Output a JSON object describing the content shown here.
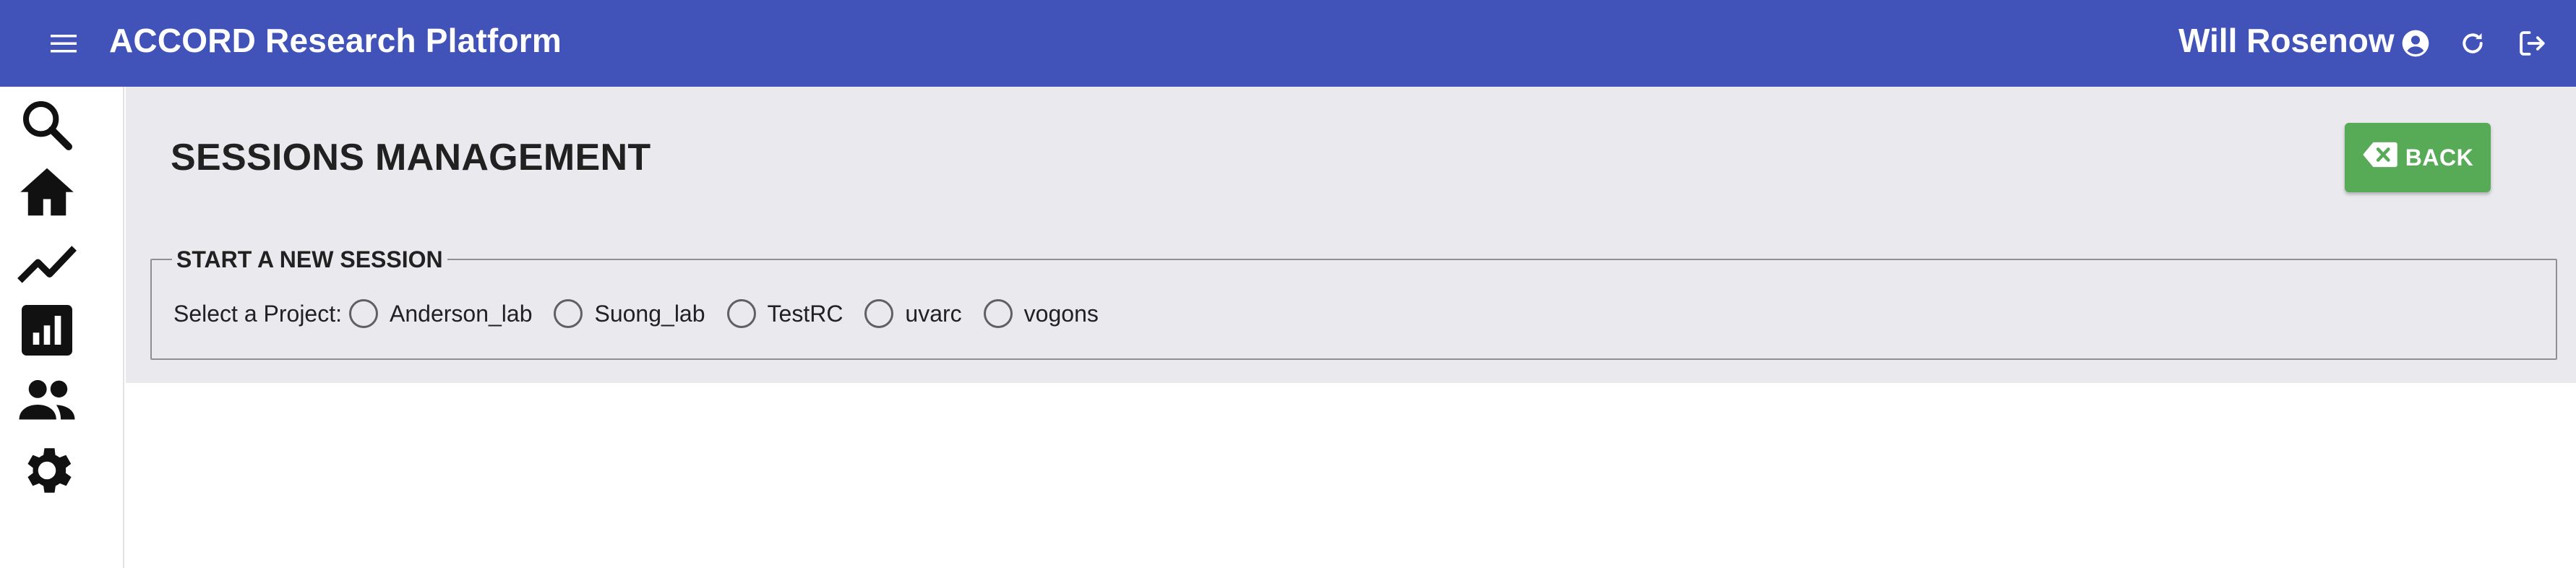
{
  "header": {
    "menu_icon": "hamburger-menu-icon",
    "title": "ACCORD Research Platform",
    "user_name": "Will Rosenow",
    "icons": [
      "account-circle-icon",
      "refresh-icon",
      "logout-icon"
    ],
    "background_color": "#4152b8"
  },
  "sidebar": {
    "items": [
      {
        "icon": "search-icon"
      },
      {
        "icon": "home-icon"
      },
      {
        "icon": "trending-line-icon"
      },
      {
        "icon": "bar-chart-icon"
      },
      {
        "icon": "people-icon"
      },
      {
        "icon": "gear-icon"
      }
    ]
  },
  "main": {
    "page_title": "SESSIONS MANAGEMENT",
    "back_button": {
      "label": "BACK",
      "icon": "backspace-icon",
      "color": "#57ab57"
    },
    "new_session": {
      "legend": "START A NEW SESSION",
      "select_label": "Select a Project:",
      "projects": [
        "Anderson_lab",
        "Suong_lab",
        "TestRC",
        "uvarc",
        "vogons"
      ]
    }
  }
}
